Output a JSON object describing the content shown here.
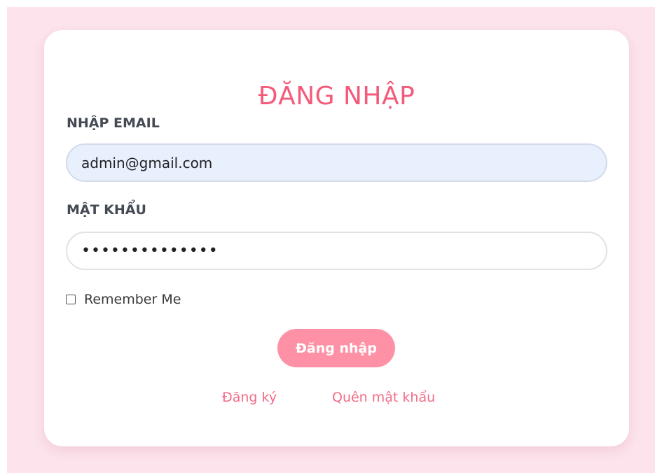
{
  "login": {
    "title": "ĐĂNG NHẬP",
    "email_label": "NHẬP EMAIL",
    "email_value": "admin@gmail.com",
    "password_label": "MẬT KHẨU",
    "password_value": "••••••••••••••",
    "remember_label": "Remember Me",
    "remember_checked": false,
    "submit_label": "Đăng nhập",
    "register_link": "Đăng ký",
    "forgot_link": "Quên mật khẩu"
  },
  "colors": {
    "page_background": "#fde4ec",
    "accent": "#f35b7b",
    "button": "#fe91a5",
    "email_input_fill": "#e8f0fe"
  }
}
